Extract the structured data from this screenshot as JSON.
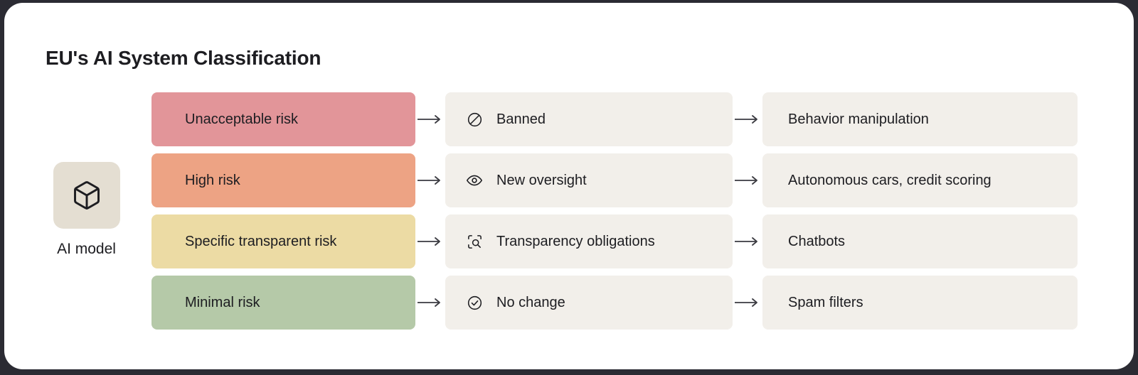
{
  "card": {
    "title": "EU's AI System Classification",
    "background": "#ffffff"
  },
  "source_node": {
    "label": "AI model",
    "icon": "cube-icon",
    "tile_color": "#e4ded2"
  },
  "colors": {
    "neutral_box": "#f2efea",
    "text": "#1d1d21",
    "unacceptable": "#e29599",
    "high": "#eda384",
    "specific": "#ecdba4",
    "minimal": "#b5c9a8"
  },
  "rows": [
    {
      "risk": "Unacceptable risk",
      "risk_color": "#e29599",
      "action": "Banned",
      "action_icon": "ban-icon",
      "example": "Behavior manipulation"
    },
    {
      "risk": "High risk",
      "risk_color": "#eda384",
      "action": "New oversight",
      "action_icon": "eye-icon",
      "example": "Autonomous cars, credit scoring"
    },
    {
      "risk": "Specific transparent risk",
      "risk_color": "#ecdba4",
      "action": "Transparency obligations",
      "action_icon": "scan-search-icon",
      "example": "Chatbots"
    },
    {
      "risk": "Minimal risk",
      "risk_color": "#b5c9a8",
      "action": "No change",
      "action_icon": "check-circle-icon",
      "example": "Spam filters"
    }
  ]
}
